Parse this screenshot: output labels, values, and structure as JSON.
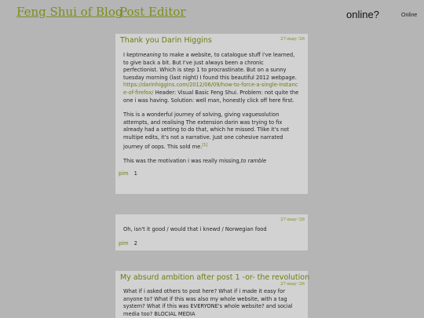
{
  "header": {
    "brand": "Feng Shui of Blog",
    "editor_link": "Post Editor",
    "online_question": "online?",
    "online_status": "Online"
  },
  "posts": [
    {
      "title": "Thank you Darin Higgins",
      "date": "27-may-'26",
      "p1_a": "I kept",
      "p1_em": "meaning",
      "p1_b": " to make a website, to catalogue stuff i've learned, to give back a bit. But I've just always been a chronic perfectionist. Which is step 1 to procrastinate. But on a sunny tuesday morning (last night) I found this beautiful 2012 webpage.",
      "link": "https://darinhiggins.com/2012/06/09/how-to-force-a-single-instance-of-firefox/",
      "p1_c": " Header: Visual Basic Feng Shui. Problem: not quite the one i was having. Solution: well man, honestly click off here first.",
      "p2": "This is a wonderful journey of solving, giving vaguesolution attempts, and realising The extension darin was trying to fix already had a setting to do that, which he missed. Tlike it's not multipe edits, it's not a narrative. Just one cohesive narrated journey of oops. This sold me.",
      "footnote": "[1]",
      "p3_a": "This was the motivation i was really missing,",
      "p3_em": "to ramble",
      "author": "pim",
      "count": "1"
    },
    {
      "date": "27-may-'26",
      "body": "Oh, isn't it good / would that i knewd / Norwegian food",
      "author": "pim",
      "count": "2"
    },
    {
      "title": "My absurd ambition after post 1 -or- the revolution",
      "date": "27-may-'26",
      "body": "What if i asked others to post here? What if i made it easy for anyone to? What if this was also my whole website, with a tag system? What if this was EVERYONE's whole website? and social media too? BLOCIAL MEDIA"
    }
  ]
}
